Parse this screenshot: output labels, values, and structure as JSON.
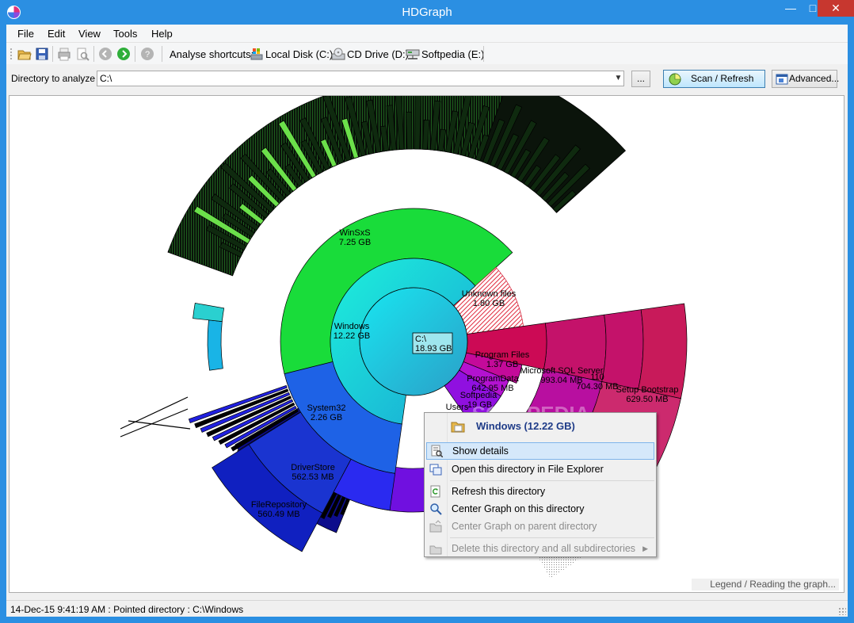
{
  "window": {
    "title": "HDGraph"
  },
  "menu": [
    "File",
    "Edit",
    "View",
    "Tools",
    "Help"
  ],
  "toolbar": {
    "analyse_label": "Analyse shortcuts:",
    "shortcuts": [
      "Local Disk (C:)",
      "CD Drive (D:)",
      "Softpedia (E:)"
    ]
  },
  "directory": {
    "label": "Directory to analyze :",
    "value": "C:\\",
    "browse_label": "...",
    "scan_label": "Scan / Refresh",
    "advanced_label": "Advanced..."
  },
  "graph": {
    "root": {
      "name": "C:\\",
      "size": "18.93 GB"
    },
    "segments": [
      {
        "name": "Windows",
        "size": "12.22 GB"
      },
      {
        "name": "WinSxS",
        "size": "7.25 GB"
      },
      {
        "name": "System32",
        "size": "2.26 GB"
      },
      {
        "name": "DriverStore",
        "size": "562.53 MB"
      },
      {
        "name": "FileRepository",
        "size": "560.49 MB"
      },
      {
        "name": "Unknown files",
        "size": "1.80 GB"
      },
      {
        "name": "Program Files",
        "size": "1.37 GB"
      },
      {
        "name": "ProgramData",
        "size": "642.95 MB"
      },
      {
        "name": "Softpedia",
        "size": ".19 GB"
      },
      {
        "name": "Users",
        "size": ""
      },
      {
        "name": "Microsoft SQL Server",
        "size": "993.04 MB"
      },
      {
        "name": "110",
        "size": "704.30 MB"
      },
      {
        "name": "Setup Bootstrap",
        "size": "629.50 MB"
      }
    ],
    "legend_link": "Legend / Reading the graph...",
    "watermark": "SOFTPEDIA"
  },
  "context_menu": {
    "header": "Windows (12.22 GB)",
    "items": [
      "Show details",
      "Open this directory in File Explorer",
      "Refresh this directory",
      "Center Graph on this directory",
      "Center Graph on parent directory",
      "Delete this directory and all subdirectories"
    ]
  },
  "status": {
    "text": "14-Dec-15 9:41:19 AM : Pointed directory : C:\\Windows"
  }
}
